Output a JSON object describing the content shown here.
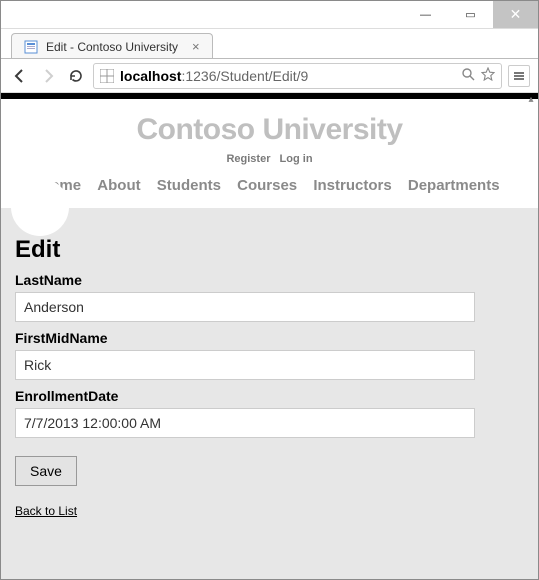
{
  "window": {
    "tab_title": "Edit - Contoso University",
    "min_glyph": "—",
    "max_glyph": "▭",
    "close_glyph": "✕"
  },
  "toolbar": {
    "url_host": "localhost",
    "url_path": ":1236/Student/Edit/9"
  },
  "masthead": {
    "title": "Contoso University",
    "register": "Register",
    "login": "Log in"
  },
  "nav": {
    "home": "Home",
    "about": "About",
    "students": "Students",
    "courses": "Courses",
    "instructors": "Instructors",
    "departments": "Departments"
  },
  "form": {
    "heading": "Edit",
    "lastname_label": "LastName",
    "lastname_value": "Anderson",
    "firstmidname_label": "FirstMidName",
    "firstmidname_value": "Rick",
    "enrollmentdate_label": "EnrollmentDate",
    "enrollmentdate_value": "7/7/2013 12:00:00 AM",
    "save_label": "Save",
    "back_label": "Back to List"
  }
}
